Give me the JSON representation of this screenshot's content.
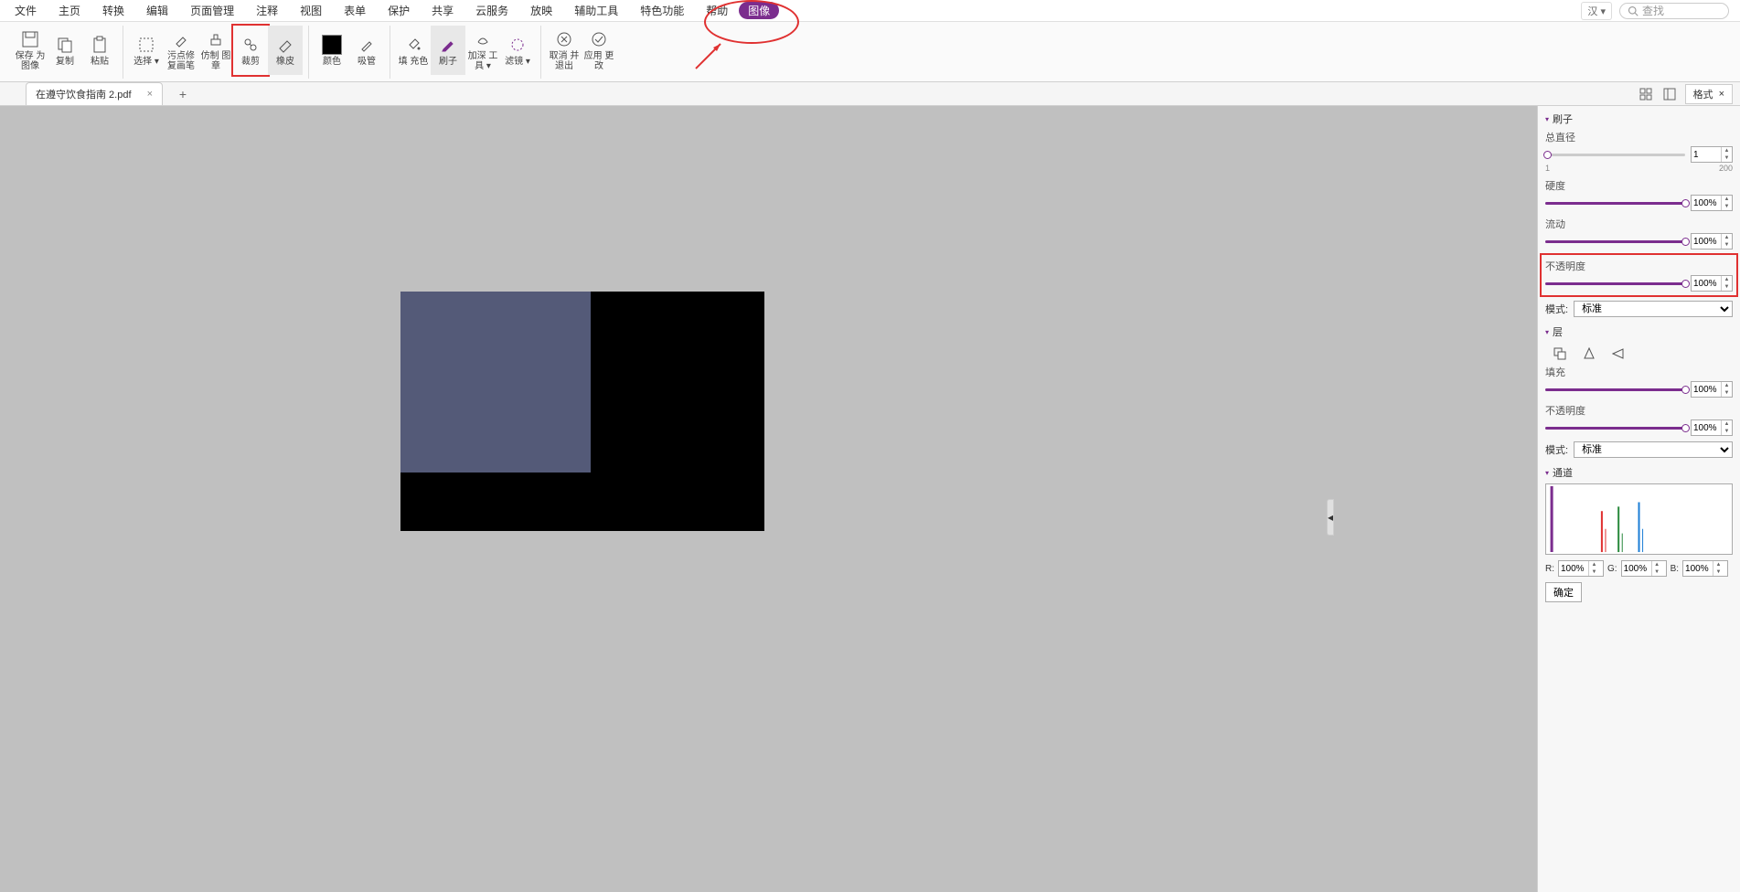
{
  "menu": {
    "items": [
      "文件",
      "主页",
      "转换",
      "编辑",
      "页面管理",
      "注释",
      "视图",
      "表单",
      "保护",
      "共享",
      "云服务",
      "放映",
      "辅助工具",
      "特色功能",
      "帮助",
      "图像"
    ],
    "highlighted_index": 15,
    "search_placeholder": "查找",
    "lang_label": "汉 ▾"
  },
  "toolbar": {
    "groups": [
      {
        "items": [
          {
            "label": "保存\n为图像",
            "icon": "save"
          },
          {
            "label": "复制",
            "icon": "copy"
          },
          {
            "label": "粘贴",
            "icon": "paste"
          }
        ]
      },
      {
        "items": [
          {
            "label": "选择 ▾",
            "icon": "select"
          },
          {
            "label": "污点修\n复画笔",
            "icon": "spot"
          },
          {
            "label": "仿制\n图章",
            "icon": "clone"
          },
          {
            "label": "裁剪",
            "icon": "crop",
            "hl": true
          },
          {
            "label": "橡皮",
            "icon": "eraser",
            "sel": true
          }
        ]
      },
      {
        "items": [
          {
            "label": "颜色",
            "icon": "color"
          },
          {
            "label": "吸管",
            "icon": "eyedrop"
          }
        ]
      },
      {
        "items": [
          {
            "label": "填\n充色",
            "icon": "fill"
          },
          {
            "label": "刷子",
            "icon": "brush",
            "sel": true
          },
          {
            "label": "加深\n工具 ▾",
            "icon": "burn"
          },
          {
            "label": "滤镜 ▾",
            "icon": "filter"
          }
        ]
      },
      {
        "items": [
          {
            "label": "取消\n并退出",
            "icon": "cancel"
          },
          {
            "label": "应用\n更改",
            "icon": "apply"
          }
        ]
      }
    ]
  },
  "tab": {
    "filename": "在遵守饮食指南 2.pdf",
    "format_tab": "格式"
  },
  "panel": {
    "brush": {
      "title": "刷子",
      "diameter_label": "总直径",
      "diameter_value": "1",
      "diameter_min": "1",
      "diameter_max": "200",
      "hardness_label": "硬度",
      "hardness_value": "100%",
      "flow_label": "流动",
      "flow_value": "100%",
      "opacity_label": "不透明度",
      "opacity_value": "100%",
      "mode_label": "模式:",
      "mode_value": "标准"
    },
    "layer": {
      "title": "层",
      "fill_label": "填充",
      "fill_value": "100%",
      "opacity_label": "不透明度",
      "opacity_value": "100%",
      "mode_label": "模式:",
      "mode_value": "标准"
    },
    "channel": {
      "title": "通道",
      "r_label": "R:",
      "r_value": "100%",
      "g_label": "G:",
      "g_value": "100%",
      "b_label": "B:",
      "b_value": "100%",
      "ok": "确定"
    }
  }
}
